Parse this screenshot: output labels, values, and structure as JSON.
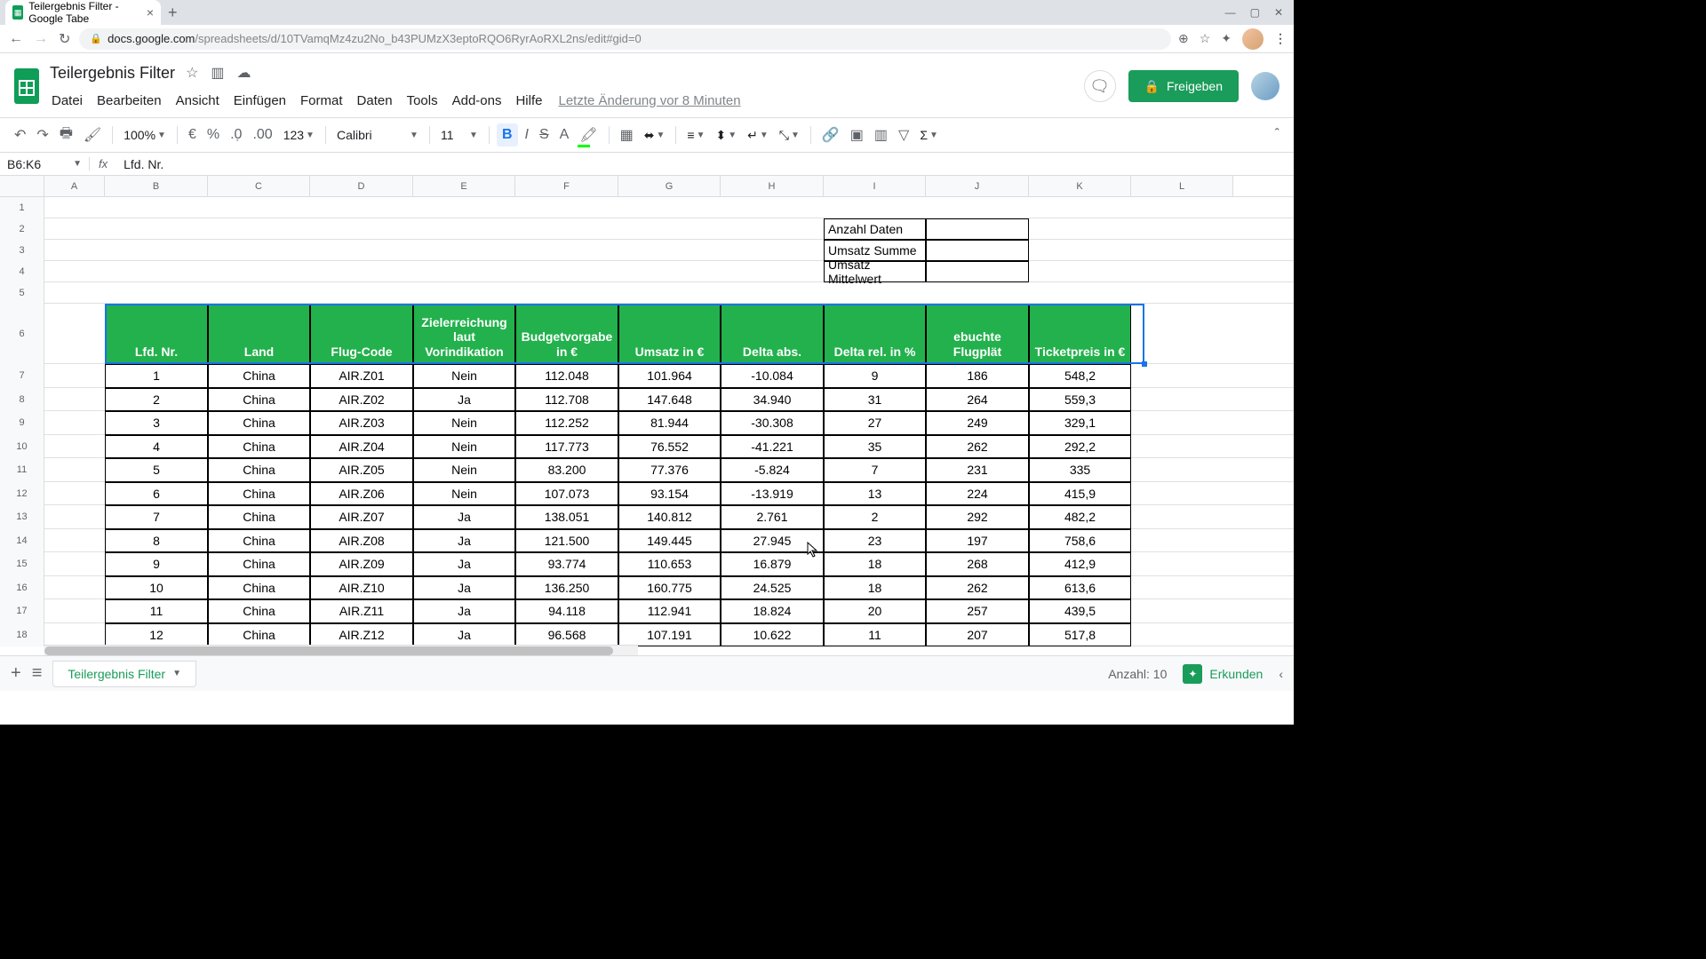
{
  "browser": {
    "tab_title": "Teilergebnis Filter - Google Tabe",
    "url_host": "docs.google.com",
    "url_path": "/spreadsheets/d/10TVamqMz4zu2No_b43PUMzX3eptoRQO6RyrAoRXL2ns/edit#gid=0"
  },
  "doc": {
    "title": "Teilergebnis Filter",
    "last_edit": "Letzte Änderung vor 8 Minuten",
    "share": "Freigeben"
  },
  "menu": [
    "Datei",
    "Bearbeiten",
    "Ansicht",
    "Einfügen",
    "Format",
    "Daten",
    "Tools",
    "Add-ons",
    "Hilfe"
  ],
  "toolbar": {
    "zoom": "100%",
    "font": "Calibri",
    "size": "11"
  },
  "namebox": "B6:K6",
  "formula": "Lfd. Nr.",
  "cols": [
    "A",
    "B",
    "C",
    "D",
    "E",
    "F",
    "G",
    "H",
    "I",
    "J",
    "K",
    "L"
  ],
  "rownums": [
    "1",
    "2",
    "3",
    "4",
    "5",
    "6",
    "7",
    "8",
    "9",
    "10",
    "11",
    "12",
    "13",
    "14",
    "15",
    "16",
    "17",
    "18"
  ],
  "info": {
    "l1": "Anzahl Daten",
    "l2": "Umsatz Summe",
    "l3": "Umsatz Mittelwert"
  },
  "headers": [
    "Lfd. Nr.",
    "Land",
    "Flug-Code",
    "Zielerreichung laut Vorindikation",
    "Budgetvorgabe in €",
    "Umsatz in €",
    "Delta abs.",
    "Delta rel. in %",
    "ebuchte Flugplät",
    "Ticketpreis in €"
  ],
  "data": [
    [
      "1",
      "China",
      "AIR.Z01",
      "Nein",
      "112.048",
      "101.964",
      "-10.084",
      "9",
      "186",
      "548,2"
    ],
    [
      "2",
      "China",
      "AIR.Z02",
      "Ja",
      "112.708",
      "147.648",
      "34.940",
      "31",
      "264",
      "559,3"
    ],
    [
      "3",
      "China",
      "AIR.Z03",
      "Nein",
      "112.252",
      "81.944",
      "-30.308",
      "27",
      "249",
      "329,1"
    ],
    [
      "4",
      "China",
      "AIR.Z04",
      "Nein",
      "117.773",
      "76.552",
      "-41.221",
      "35",
      "262",
      "292,2"
    ],
    [
      "5",
      "China",
      "AIR.Z05",
      "Nein",
      "83.200",
      "77.376",
      "-5.824",
      "7",
      "231",
      "335"
    ],
    [
      "6",
      "China",
      "AIR.Z06",
      "Nein",
      "107.073",
      "93.154",
      "-13.919",
      "13",
      "224",
      "415,9"
    ],
    [
      "7",
      "China",
      "AIR.Z07",
      "Ja",
      "138.051",
      "140.812",
      "2.761",
      "2",
      "292",
      "482,2"
    ],
    [
      "8",
      "China",
      "AIR.Z08",
      "Ja",
      "121.500",
      "149.445",
      "27.945",
      "23",
      "197",
      "758,6"
    ],
    [
      "9",
      "China",
      "AIR.Z09",
      "Ja",
      "93.774",
      "110.653",
      "16.879",
      "18",
      "268",
      "412,9"
    ],
    [
      "10",
      "China",
      "AIR.Z10",
      "Ja",
      "136.250",
      "160.775",
      "24.525",
      "18",
      "262",
      "613,6"
    ],
    [
      "11",
      "China",
      "AIR.Z11",
      "Ja",
      "94.118",
      "112.941",
      "18.824",
      "20",
      "257",
      "439,5"
    ],
    [
      "12",
      "China",
      "AIR.Z12",
      "Ja",
      "96.568",
      "107.191",
      "10.622",
      "11",
      "207",
      "517,8"
    ]
  ],
  "footer": {
    "sheet": "Teilergebnis Filter",
    "count": "Anzahl: 10",
    "explore": "Erkunden"
  }
}
